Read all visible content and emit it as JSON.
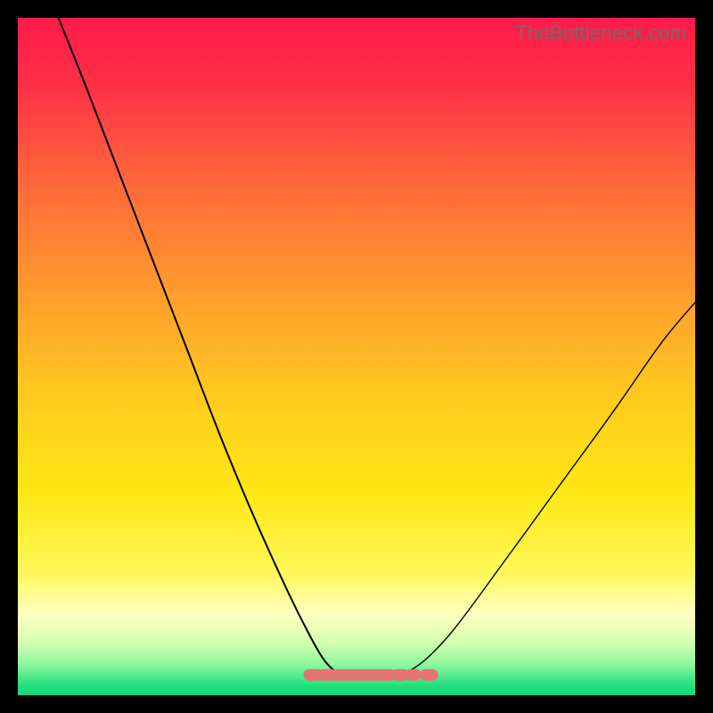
{
  "watermark": "TheBottleneck.com",
  "chart_data": {
    "type": "line",
    "title": "",
    "xlabel": "",
    "ylabel": "",
    "xlim": [
      0,
      100
    ],
    "ylim": [
      0,
      100
    ],
    "grid": false,
    "legend": false,
    "annotations": [],
    "background_gradient": {
      "stops": [
        {
          "offset": 0.0,
          "color": "#ff1a4b"
        },
        {
          "offset": 0.1,
          "color": "#ff3046"
        },
        {
          "offset": 0.25,
          "color": "#ff6a3a"
        },
        {
          "offset": 0.4,
          "color": "#ff9a2e"
        },
        {
          "offset": 0.55,
          "color": "#ffc81f"
        },
        {
          "offset": 0.7,
          "color": "#ffe714"
        },
        {
          "offset": 0.82,
          "color": "#fff85a"
        },
        {
          "offset": 0.88,
          "color": "#ffffc0"
        },
        {
          "offset": 0.92,
          "color": "#d8ffb0"
        },
        {
          "offset": 0.955,
          "color": "#8cf7a0"
        },
        {
          "offset": 0.985,
          "color": "#24e07e"
        },
        {
          "offset": 1.0,
          "color": "#18d878"
        }
      ]
    },
    "series": [
      {
        "name": "left-curve",
        "color": "#000000",
        "width": 2.0,
        "x": [
          6,
          10,
          15,
          20,
          25,
          30,
          35,
          40,
          43,
          45,
          46.5,
          47.5
        ],
        "y": [
          100,
          90,
          77,
          64,
          51,
          38,
          26,
          15,
          9,
          5.5,
          3.8,
          3.3
        ]
      },
      {
        "name": "right-curve",
        "color": "#000000",
        "width": 1.4,
        "x": [
          57,
          58.5,
          61,
          65,
          72,
          80,
          88,
          95,
          100
        ],
        "y": [
          3.3,
          4.0,
          6.0,
          10.5,
          20,
          31,
          42,
          52,
          58
        ]
      },
      {
        "name": "valley-floor",
        "color": "#e57373",
        "style": "pill-segments",
        "x_segments": [
          [
            43.0,
            44.5
          ],
          [
            45.0,
            46.3
          ],
          [
            47.0,
            55.0
          ],
          [
            56.0,
            57.0
          ],
          [
            58.0,
            58.8
          ],
          [
            60.2,
            61.2
          ]
        ],
        "y": 3.0
      }
    ]
  }
}
